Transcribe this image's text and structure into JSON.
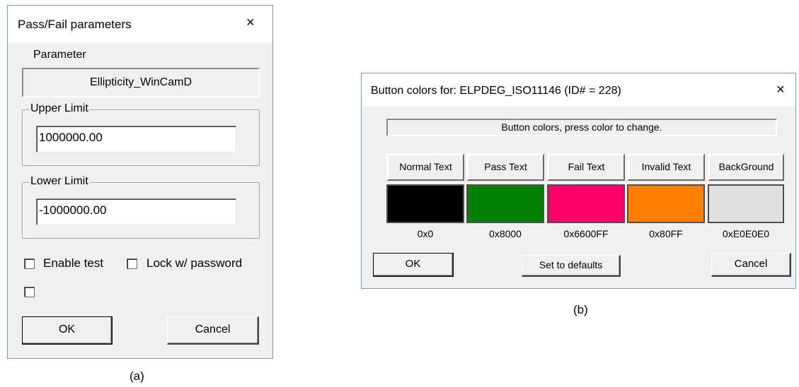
{
  "dialog_a": {
    "title": "Pass/Fail  parameters",
    "close_glyph": "×",
    "parameter_label": "Parameter",
    "parameter_value": "Ellipticity_WinCamD",
    "upper_limit_label": "Upper Limit",
    "upper_limit_value": "1000000.00",
    "lower_limit_label": "Lower Limit",
    "lower_limit_value": "-1000000.00",
    "enable_test_label": "Enable test",
    "lock_password_label": "Lock w/ password",
    "ok_label": "OK",
    "cancel_label": "Cancel",
    "caption": "(a)"
  },
  "dialog_b": {
    "title": "Button colors for:  ELPDEG_ISO11146 (ID# = 228)",
    "close_glyph": "×",
    "instruction": "Button colors, press color to change.",
    "colors": [
      {
        "label": "Normal Text",
        "hex": "0x0",
        "swatch": "#000000"
      },
      {
        "label": "Pass Text",
        "hex": "0x8000",
        "swatch": "#008000"
      },
      {
        "label": "Fail Text",
        "hex": "0x6600FF",
        "swatch": "#ff0066"
      },
      {
        "label": "Invalid Text",
        "hex": "0x80FF",
        "swatch": "#ff8000"
      },
      {
        "label": "BackGround",
        "hex": "0xE0E0E0",
        "swatch": "#e0e0e0"
      }
    ],
    "ok_label": "OK",
    "defaults_label": "Set to defaults",
    "cancel_label": "Cancel",
    "caption": "(b)"
  }
}
